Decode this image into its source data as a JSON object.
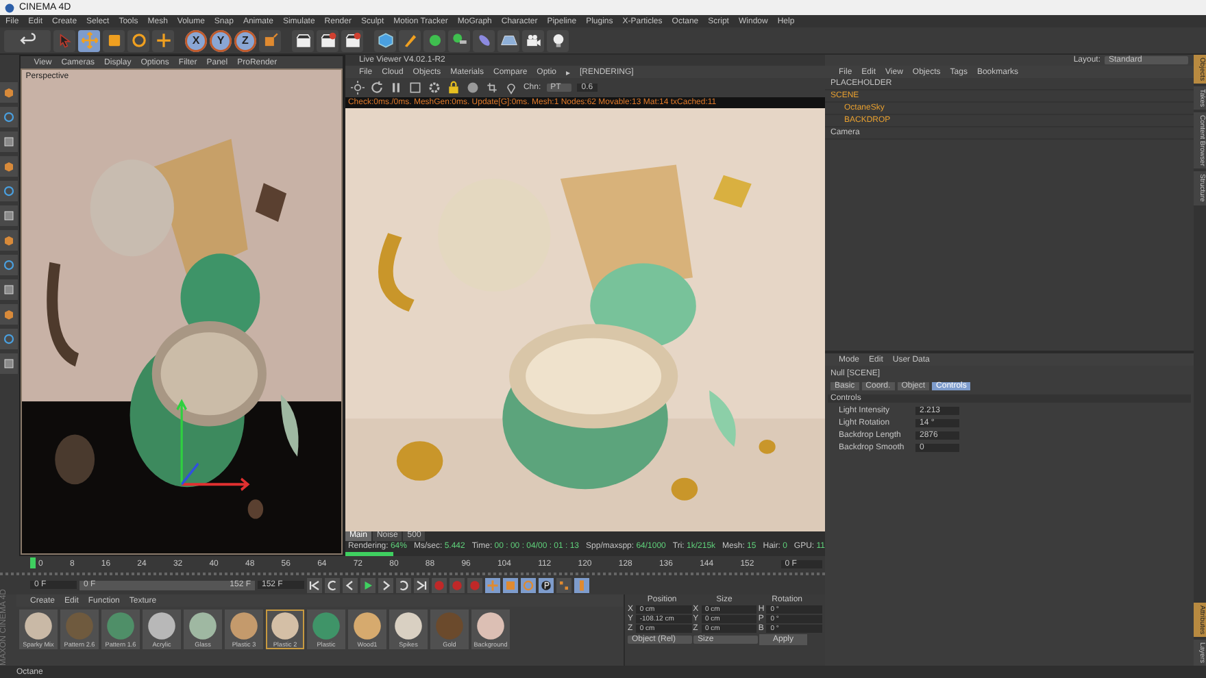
{
  "window": {
    "title": "CINEMA 4D"
  },
  "menu": [
    "File",
    "Edit",
    "Create",
    "Select",
    "Tools",
    "Mesh",
    "Volume",
    "Snap",
    "Animate",
    "Simulate",
    "Render",
    "Sculpt",
    "Motion Tracker",
    "MoGraph",
    "Character",
    "Pipeline",
    "Plugins",
    "X-Particles",
    "Octane",
    "Script",
    "Window",
    "Help"
  ],
  "layout": {
    "label": "Layout:",
    "value": "Standard"
  },
  "toolbar": {
    "tools": [
      {
        "selected": false
      },
      {
        "selected": true
      },
      {
        "selected": false
      },
      {
        "selected": false
      },
      {
        "selected": false
      }
    ],
    "axes": [
      {
        "label": "X",
        "selected": true
      },
      {
        "label": "Y",
        "selected": true
      },
      {
        "label": "Z",
        "selected": true
      }
    ]
  },
  "viewport": {
    "menu": [
      "View",
      "Cameras",
      "Display",
      "Options",
      "Filter",
      "Panel",
      "ProRender"
    ],
    "camera_label": "Perspective"
  },
  "live_viewer": {
    "title": "Live Viewer V4.02.1-R2",
    "menu": [
      "File",
      "Cloud",
      "Objects",
      "Materials",
      "Compare",
      "Optio"
    ],
    "menu_more": "▸",
    "status_tag": "[RENDERING]",
    "channel_label": "Chn:",
    "channel_value": "PT",
    "channel_field": "0.6",
    "log": "Check:0ms./0ms. MeshGen:0ms. Update[G]:0ms. Mesh:1 Nodes:62 Movable:13 Mat:14 txCached:11",
    "tabs": [
      {
        "label": "Main",
        "selected": true
      },
      {
        "label": "Noise",
        "selected": false
      },
      {
        "label": "500",
        "selected": false
      }
    ],
    "stats": [
      {
        "label": "Rendering:",
        "value": "64%"
      },
      {
        "label": "Ms/sec:",
        "value": "5.442"
      },
      {
        "label": "Time:",
        "value": "00 : 00 : 04/00 : 01 : 13"
      },
      {
        "label": "Spp/maxspp:",
        "value": "64/1000"
      },
      {
        "label": "Tri:",
        "value": "1k/215k"
      },
      {
        "label": "Mesh:",
        "value": "15"
      },
      {
        "label": "Hair:",
        "value": "0"
      },
      {
        "label": "GPU:",
        "value": "11"
      }
    ],
    "progress": {
      "level": 0.1
    }
  },
  "timeline": {
    "range": {
      "level": 1
    },
    "ticks": [
      "0",
      "8",
      "16",
      "24",
      "32",
      "40",
      "48",
      "56",
      "64",
      "72",
      "80",
      "88",
      "96",
      "104",
      "112",
      "120",
      "128",
      "136",
      "144",
      "152"
    ],
    "playhead": {
      "level": 0
    },
    "current": "0 F",
    "range_start": "0 F",
    "range_end": "152 F",
    "end": "152 F",
    "right_field": "0 F"
  },
  "materials": {
    "menu": [
      "Create",
      "Edit",
      "Function",
      "Texture"
    ],
    "items": [
      {
        "name": "Sparky Mix",
        "color": "#c9b9a6",
        "selected": false
      },
      {
        "name": "Pattern 2.6",
        "color": "#6f5a3e",
        "selected": false
      },
      {
        "name": "Pattern 1.6",
        "color": "#4f8f68",
        "selected": false
      },
      {
        "name": "Acrylic",
        "color": "#b8b8b8",
        "selected": false
      },
      {
        "name": "Glass",
        "color": "#9fb8a2",
        "selected": false
      },
      {
        "name": "Plastic 3",
        "color": "#c49a6c",
        "selected": false
      },
      {
        "name": "Plastic 2",
        "color": "#d4bfa6",
        "selected": true
      },
      {
        "name": "Plastic",
        "color": "#3f9468",
        "selected": false
      },
      {
        "name": "Wood1",
        "color": "#d6aa6e",
        "selected": false
      },
      {
        "name": "Spikes",
        "color": "#d9d0c2",
        "selected": false
      },
      {
        "name": "Gold",
        "color": "#6b4a2c",
        "selected": false
      },
      {
        "name": "Background",
        "color": "#dcbfb4",
        "selected": false
      }
    ],
    "brand": "MAXON CINEMA 4D"
  },
  "coordinates": {
    "headers": [
      "Position",
      "Size",
      "Rotation"
    ],
    "rows": [
      {
        "axis": "X",
        "position": "0 cm",
        "size_axis": "X",
        "size": "0 cm",
        "rot_axis": "H",
        "rotation": "0 °"
      },
      {
        "axis": "Y",
        "position": "-108.12 cm",
        "size_axis": "Y",
        "size": "0 cm",
        "rot_axis": "P",
        "rotation": "0 °"
      },
      {
        "axis": "Z",
        "position": "0 cm",
        "size_axis": "Z",
        "size": "0 cm",
        "rot_axis": "B",
        "rotation": "0 °"
      }
    ],
    "mode": "Object (Rel)",
    "size_mode": "Size",
    "apply": "Apply"
  },
  "objects": {
    "menu": [
      "File",
      "Edit",
      "View",
      "Objects",
      "Tags",
      "Bookmarks"
    ],
    "items": [
      {
        "name": "PLACEHOLDER",
        "selected": false
      },
      {
        "name": "SCENE",
        "selected": true,
        "children": [
          {
            "name": "OctaneSky",
            "selected": true
          },
          {
            "name": "BACKDROP",
            "selected": true
          }
        ]
      },
      {
        "name": "Camera",
        "selected": false
      }
    ],
    "side_tabs": [
      {
        "label": "Objects",
        "selected": true
      },
      {
        "label": "Takes",
        "selected": false
      },
      {
        "label": "Content Browser",
        "selected": false
      },
      {
        "label": "Structure",
        "selected": false
      }
    ]
  },
  "attributes": {
    "menu": [
      "Mode",
      "Edit",
      "User Data"
    ],
    "title": "Null [SCENE]",
    "tabs": [
      {
        "label": "Basic",
        "selected": false
      },
      {
        "label": "Coord.",
        "selected": false
      },
      {
        "label": "Object",
        "selected": false
      },
      {
        "label": "Controls",
        "selected": true
      }
    ],
    "section": "Controls",
    "fields": [
      {
        "label": "Light Intensity",
        "value": "2.213"
      },
      {
        "label": "Light Rotation",
        "value": "14 °"
      },
      {
        "label": "Backdrop Length",
        "value": "2876"
      },
      {
        "label": "Backdrop Smooth",
        "value": "0"
      }
    ],
    "side_tabs": [
      {
        "label": "Attributes",
        "selected": true
      },
      {
        "label": "Layers",
        "selected": false
      }
    ]
  },
  "status_bar": {
    "text": "Octane"
  }
}
